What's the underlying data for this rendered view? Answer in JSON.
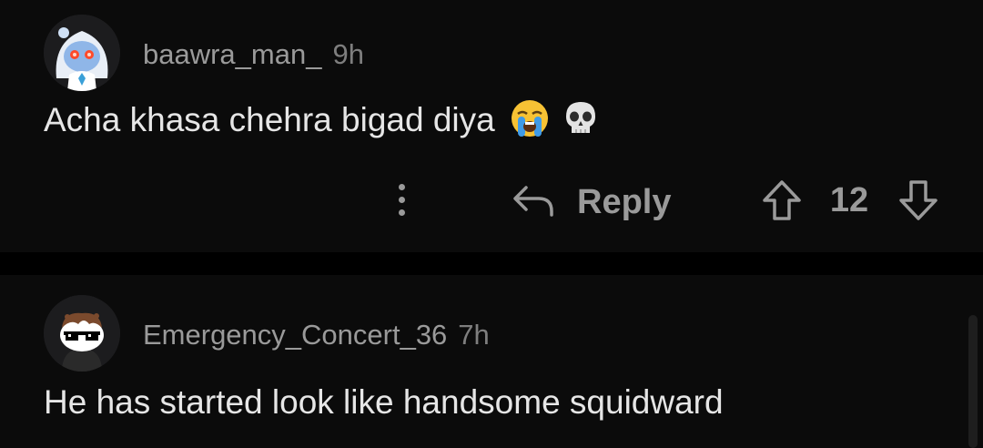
{
  "comments": [
    {
      "username": "baawra_man_",
      "age": "9h",
      "body": "Acha khasa chehra bigad diya",
      "emojis": [
        "loudly-crying-face-emoji",
        "skull-emoji"
      ],
      "actions": {
        "reply_label": "Reply",
        "vote_count": "12"
      }
    },
    {
      "username": "Emergency_Concert_36",
      "age": "7h",
      "body": "He has started look like handsome squidward"
    }
  ],
  "colors": {
    "card_background": "#0b0b0b",
    "divider": "#000000",
    "username": "#9a9a9a",
    "body_text": "#e6e6e6",
    "action_icon": "#9a9a9a"
  }
}
